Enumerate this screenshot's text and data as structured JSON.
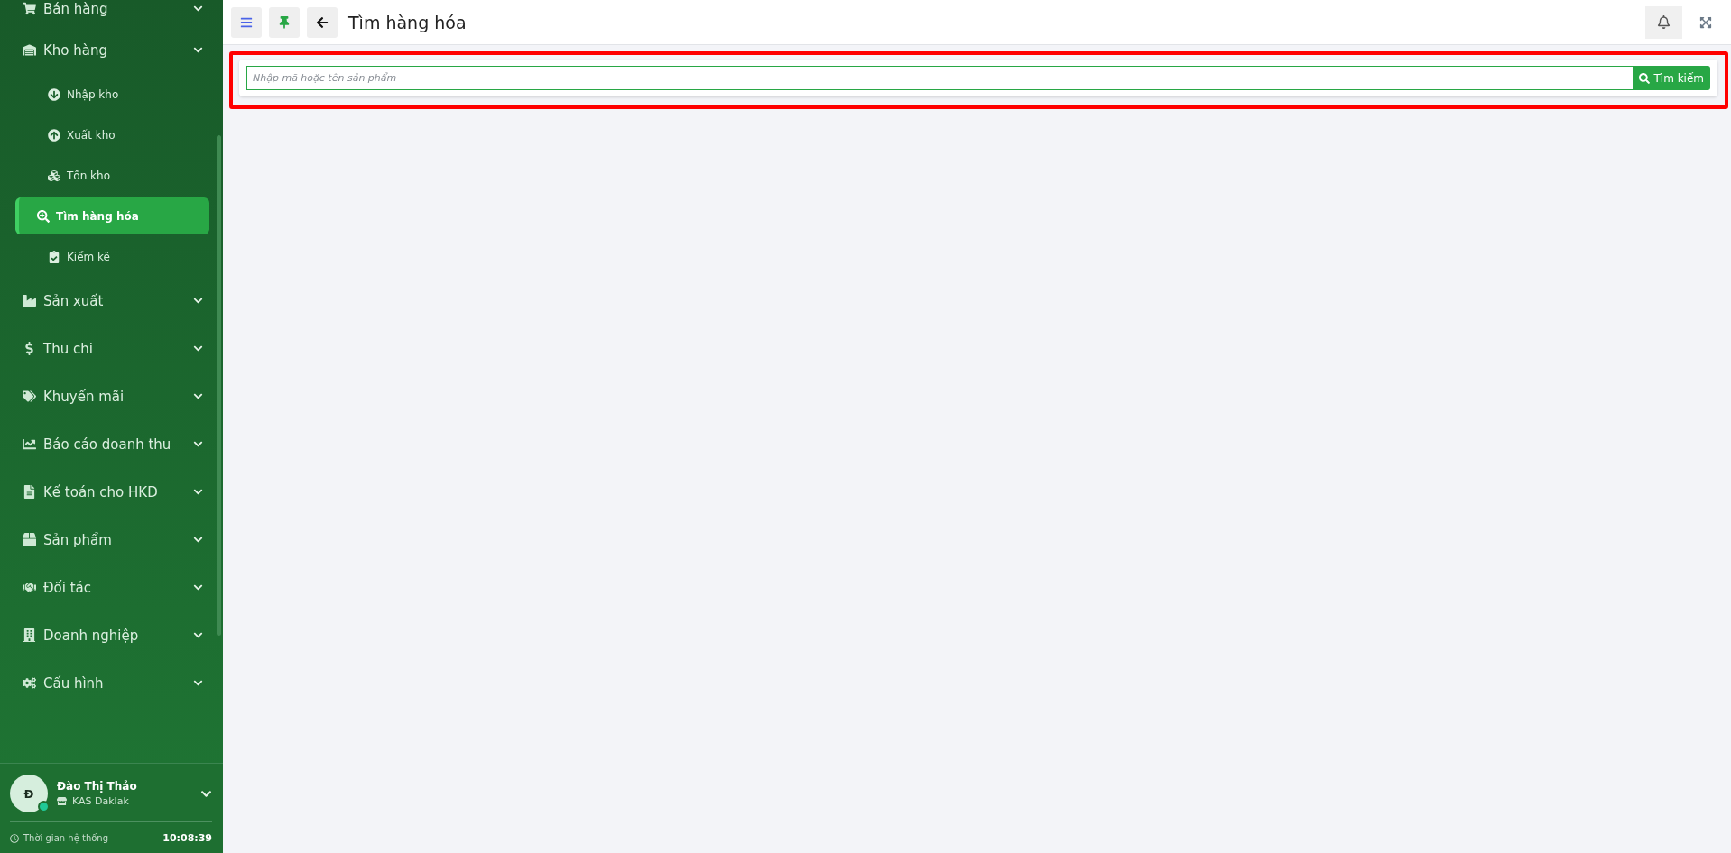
{
  "sidebar": {
    "items": [
      {
        "label": "Bán hàng"
      },
      {
        "label": "Kho hàng",
        "children": [
          {
            "label": "Nhập kho",
            "selected": false
          },
          {
            "label": "Xuất kho",
            "selected": false
          },
          {
            "label": "Tồn kho",
            "selected": false
          },
          {
            "label": "Tìm hàng hóa",
            "selected": true
          },
          {
            "label": "Kiểm kê",
            "selected": false
          }
        ]
      },
      {
        "label": "Sản xuất"
      },
      {
        "label": "Thu chi"
      },
      {
        "label": "Khuyến mãi"
      },
      {
        "label": "Báo cáo doanh thu"
      },
      {
        "label": "Kế toán cho HKD"
      },
      {
        "label": "Sản phẩm"
      },
      {
        "label": "Đối tác"
      },
      {
        "label": "Doanh nghiệp"
      },
      {
        "label": "Cấu hình"
      }
    ]
  },
  "user": {
    "avatar": "Đ",
    "online": true,
    "name": "Đào Thị Thảo",
    "store": "KAS Daklak"
  },
  "system_time": {
    "label": "Thời gian hệ thống",
    "value": "10:08:39"
  },
  "header": {
    "title": "Tìm hàng hóa"
  },
  "search": {
    "placeholder": "Nhập mã hoặc tên sản phẩm",
    "button": "Tìm kiếm"
  }
}
